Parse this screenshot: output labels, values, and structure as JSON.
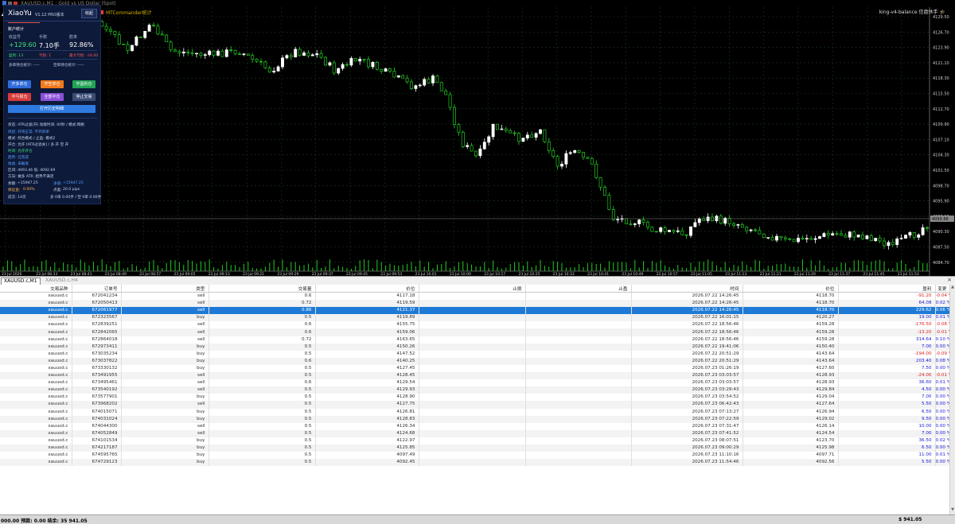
{
  "titlebar": {
    "title": "XAUUSD.c,M1 : Gold vs US Dollar (Spot)"
  },
  "chart": {
    "indicator_label": "MTCommander统计",
    "ea_label": "king-v4-balance 信盘休手",
    "price_ticks": [
      "4129.50",
      "4126.70",
      "4123.90",
      "4121.10",
      "4118.30",
      "4115.50",
      "4112.70",
      "4109.90",
      "4107.10",
      "4104.30",
      "4101.50",
      "4098.70",
      "4095.90",
      "4093.10",
      "4090.30",
      "4087.50",
      "4084.70"
    ],
    "current_price": "4093.66",
    "time_ticks": [
      "23 Jul 2026",
      "23 Jul 08:33",
      "23 Jul 08:41",
      "23 Jul 08:49",
      "23 Jul 08:57",
      "23 Jul 09:05",
      "23 Jul 09:13",
      "23 Jul 09:21",
      "23 Jul 09:29",
      "23 Jul 09:37",
      "23 Jul 09:45",
      "23 Jul 09:53",
      "23 Jul 10:01",
      "23 Jul 10:09",
      "23 Jul 10:17",
      "23 Jul 10:25",
      "23 Jul 10:33",
      "23 Jul 10:41",
      "23 Jul 10:49",
      "23 Jul 10:57",
      "23 Jul 11:05",
      "23 Jul 11:13",
      "23 Jul 11:21",
      "23 Jul 11:29",
      "23 Jul 11:37",
      "23 Jul 11:45",
      "23 Jul 11:53"
    ],
    "colors": {
      "bull": "#ffffff",
      "bear": "#22cc22",
      "grid": "#1a3a1a",
      "volume": "#22cc22"
    }
  },
  "panel": {
    "title": "XiaoYu",
    "version": "V1.12 PRO版本",
    "minimize": "收起",
    "account_section": "账户统计",
    "stats": [
      {
        "label": "收益号",
        "value": "+129.60"
      },
      {
        "label": "手数",
        "value": "7.10手"
      },
      {
        "label": "胜率",
        "value": "92.86%"
      }
    ],
    "win_count": "盈利: 13",
    "loss_count": "亏损: 1",
    "max_loss": "最大亏损: -24.00",
    "long_pos": "多单持仓统计: -----",
    "short_pos": "空单持仓统计: -----",
    "buttons": {
      "long_open": "开多单仓",
      "short_open": "开空单仓",
      "close_profit": "平盈利仓",
      "close_half": "平亏损仓",
      "close_all": "全部平仓",
      "stop_trade": "停止交易",
      "history": "打开历史明细"
    },
    "info_lines": [
      "状态: ATR过滤(开)  动能时间: 00秒 / 模式:网格",
      "风控: 开场正常, 不开新单",
      "模式: 综合模式 / 止盈: 模式2",
      "开仓: 允许 [ATR过滤关] / 多 开 空 开",
      "时间: 允许开仓",
      "趋势: 已完成",
      "收益: 未触发",
      "区间: 4093.46 低: 4092.69",
      "方向: 做多 ATR: 趋势不满足"
    ],
    "balance_label": "余额:",
    "balance_value": "+15947.25",
    "equity_label": "净值:",
    "equity_value": "+15947.25",
    "margin_label": "保证金:",
    "margin_value": "0.00%",
    "spread_label": "点差:",
    "spread_value": "20.0 pips",
    "footer_left": "成交: 14次",
    "footer_right": "多 0单 0.00手 / 空 0单 0.00手"
  },
  "tabs": [
    {
      "label": "XAUUSD.c,M1",
      "active": true
    },
    {
      "label": "XAUUSD.c,H4",
      "active": false
    }
  ],
  "table": {
    "headers": [
      "交易品种",
      "订单号",
      "类型",
      "交易量",
      "价位",
      "止损",
      "止盈",
      "时间",
      "价位",
      "盈利",
      "变更"
    ],
    "rows": [
      [
        "xauusd.c",
        "672041234",
        "sell",
        "0.6",
        "4117.18",
        "",
        "",
        "2026.07.22 14:26:45",
        "4118.70",
        "-91.20",
        "-0.04 %"
      ],
      [
        "xauusd.c",
        "672050413",
        "sell",
        "0.72",
        "4119.59",
        "",
        "",
        "2026.07.22 14:26:45",
        "4118.70",
        "64.08",
        "0.02 %"
      ],
      [
        "xauusd.c",
        "672061977",
        "sell",
        "0.86",
        "4121.37",
        "",
        "",
        "2026.07.22 14:26:45",
        "4118.70",
        "229.62",
        "0.06 %"
      ],
      [
        "xauusd.c",
        "672323567",
        "buy",
        "0.5",
        "4119.89",
        "",
        "",
        "2026.07.22 16:01:15",
        "4120.27",
        "19.00",
        "0.01 %"
      ],
      [
        "xauusd.c",
        "672839251",
        "sell",
        "0.6",
        "4155.75",
        "",
        "",
        "2026.07.22 18:56:46",
        "4159.28",
        "-176.50",
        "-0.08 %"
      ],
      [
        "xauusd.c",
        "672842065",
        "sell",
        "0.6",
        "4159.06",
        "",
        "",
        "2026.07.22 18:56:46",
        "4159.28",
        "-13.20",
        "-0.01 %"
      ],
      [
        "xauusd.c",
        "672864018",
        "sell",
        "0.72",
        "4163.65",
        "",
        "",
        "2026.07.22 18:56:46",
        "4159.28",
        "314.64",
        "0.10 %"
      ],
      [
        "xauusd.c",
        "672973411",
        "buy",
        "0.5",
        "4150.26",
        "",
        "",
        "2026.07.22 19:41:06",
        "4150.40",
        "7.00",
        "0.00 %"
      ],
      [
        "xauusd.c",
        "673035234",
        "buy",
        "0.5",
        "4147.52",
        "",
        "",
        "2026.07.22 20:51:29",
        "4143.64",
        "-194.00",
        "-0.09 %"
      ],
      [
        "xauusd.c",
        "673037822",
        "buy",
        "0.6",
        "4140.25",
        "",
        "",
        "2026.07.22 20:51:29",
        "4143.64",
        "203.40",
        "0.08 %"
      ],
      [
        "xauusd.c",
        "673330132",
        "buy",
        "0.5",
        "4127.45",
        "",
        "",
        "2026.07.23 01:26:19",
        "4127.60",
        "7.50",
        "0.00 %"
      ],
      [
        "xauusd.c",
        "673491955",
        "sell",
        "0.5",
        "4128.45",
        "",
        "",
        "2026.07.23 03:03:57",
        "4128.93",
        "-24.00",
        "-0.01 %"
      ],
      [
        "xauusd.c",
        "673495461",
        "sell",
        "0.6",
        "4129.54",
        "",
        "",
        "2026.07.23 03:03:57",
        "4128.93",
        "36.60",
        "0.01 %"
      ],
      [
        "xauusd.c",
        "673540192",
        "sell",
        "0.5",
        "4129.93",
        "",
        "",
        "2026.07.23 03:29:43",
        "4129.84",
        "4.50",
        "0.00 %"
      ],
      [
        "xauusd.c",
        "673577901",
        "buy",
        "0.5",
        "4128.90",
        "",
        "",
        "2026.07.23 03:54:52",
        "4129.04",
        "7.00",
        "0.00 %"
      ],
      [
        "xauusd.c",
        "673968202",
        "sell",
        "0.5",
        "4127.75",
        "",
        "",
        "2026.07.23 06:42:43",
        "4127.64",
        "5.50",
        "0.00 %"
      ],
      [
        "xauusd.c",
        "674015071",
        "buy",
        "0.5",
        "4126.81",
        "",
        "",
        "2026.07.23 07:13:27",
        "4126.94",
        "6.50",
        "0.00 %"
      ],
      [
        "xauusd.c",
        "674031024",
        "buy",
        "0.5",
        "4128.83",
        "",
        "",
        "2026.07.23 07:22:59",
        "4129.02",
        "9.50",
        "0.00 %"
      ],
      [
        "xauusd.c",
        "674044300",
        "sell",
        "0.5",
        "4126.34",
        "",
        "",
        "2026.07.23 07:31:47",
        "4126.14",
        "10.00",
        "0.00 %"
      ],
      [
        "xauusd.c",
        "674052849",
        "sell",
        "0.5",
        "4124.68",
        "",
        "",
        "2026.07.23 07:41:52",
        "4124.54",
        "7.00",
        "0.00 %"
      ],
      [
        "xauusd.c",
        "674101534",
        "buy",
        "0.5",
        "4122.97",
        "",
        "",
        "2026.07.23 08:07:51",
        "4123.70",
        "36.50",
        "0.02 %"
      ],
      [
        "xauusd.c",
        "674217187",
        "buy",
        "0.5",
        "4125.85",
        "",
        "",
        "2026.07.23 09:00:29",
        "4125.98",
        "6.50",
        "0.00 %"
      ],
      [
        "xauusd.c",
        "674595765",
        "buy",
        "0.5",
        "4097.49",
        "",
        "",
        "2026.07.23 11:10:16",
        "4097.71",
        "11.00",
        "0.01 %"
      ],
      [
        "xauusd.c",
        "674729123",
        "buy",
        "0.5",
        "4092.45",
        "",
        "",
        "2026.07.23 11:54:46",
        "4092.56",
        "5.50",
        "0.00 %"
      ]
    ],
    "selected_row": 2
  },
  "status": {
    "left": "000.00  预款: 0.00  结余: 35 941.05",
    "right": "$ 941.05"
  }
}
